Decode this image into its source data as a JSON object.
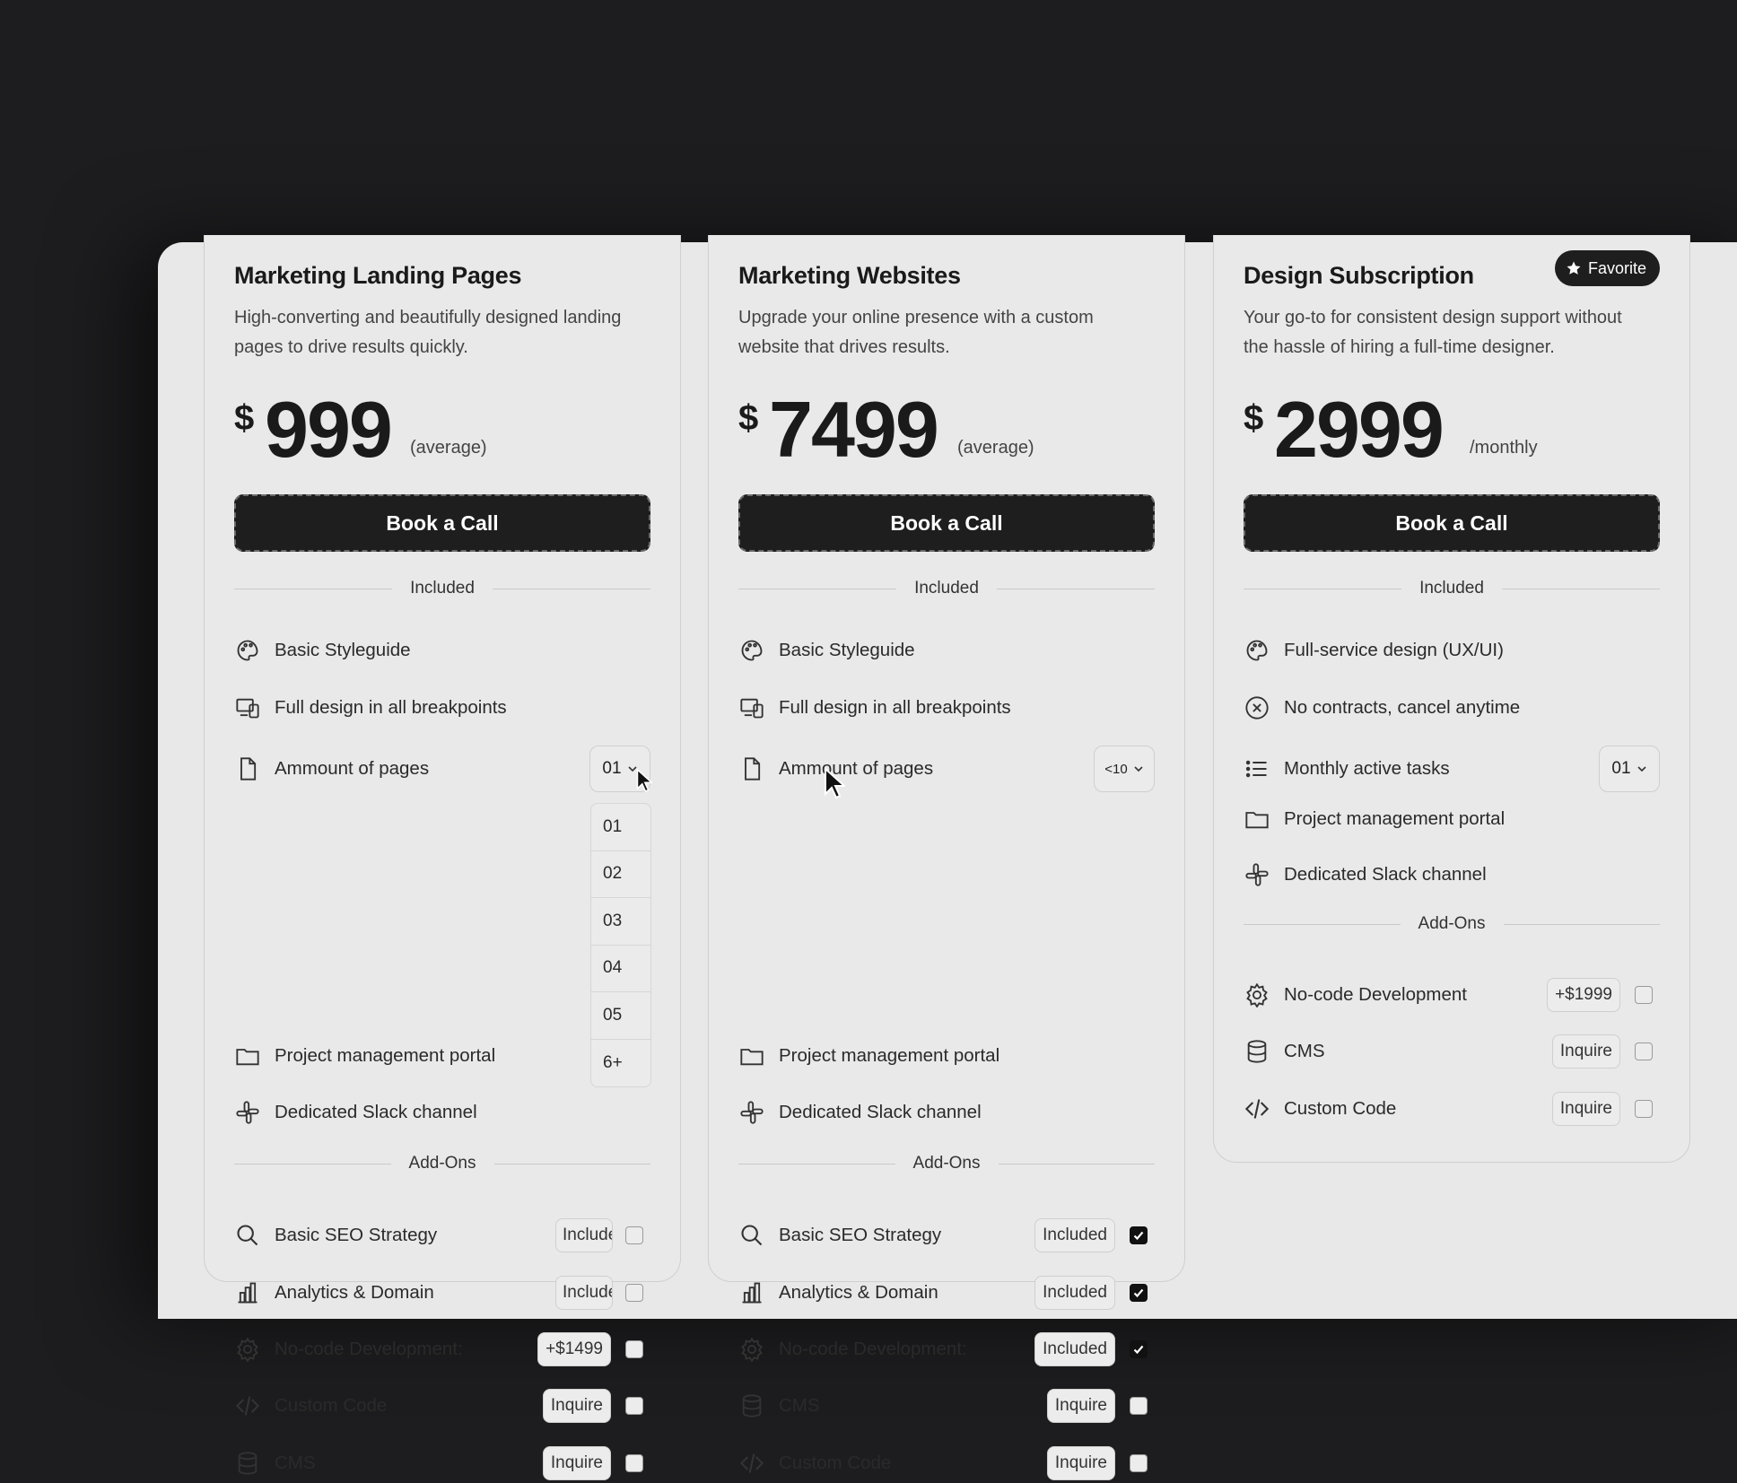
{
  "cards": [
    {
      "title": "Marketing Landing Pages",
      "description": "High-converting and beautifully designed landing pages to drive results quickly.",
      "price": {
        "currency": "$",
        "amount": "999",
        "note": "(average)"
      },
      "cta": "Book a Call",
      "included_label": "Included",
      "included": [
        {
          "icon": "palette-icon",
          "label": "Basic Styleguide"
        },
        {
          "icon": "devices-icon",
          "label": "Full design in all breakpoints"
        },
        {
          "icon": "document-icon",
          "label": "Ammount of pages",
          "select": "01"
        },
        {
          "icon": "folder-icon",
          "label": "Project management portal"
        },
        {
          "icon": "slack-icon",
          "label": "Dedicated Slack channel"
        }
      ],
      "addons_label": "Add-Ons",
      "addons": [
        {
          "icon": "search-icon",
          "label": "Basic SEO Strategy",
          "tag": "Included",
          "checked": true
        },
        {
          "icon": "bar-chart-icon",
          "label": "Analytics & Domain",
          "tag": "Included",
          "checked": true
        },
        {
          "icon": "gear-icon",
          "label": "No-code Development:",
          "tag": "+$1499",
          "checked": false
        },
        {
          "icon": "code-icon",
          "label": "Custom Code",
          "tag": "Inquire",
          "checked": false
        },
        {
          "icon": "database-icon",
          "label": "CMS",
          "tag": "Inquire",
          "checked": false
        }
      ]
    },
    {
      "title": "Marketing Websites",
      "description": "Upgrade your online presence with a custom website that drives results.",
      "price": {
        "currency": "$",
        "amount": "7499",
        "note": "(average)"
      },
      "cta": "Book a Call",
      "included_label": "Included",
      "included": [
        {
          "icon": "palette-icon",
          "label": "Basic Styleguide"
        },
        {
          "icon": "devices-icon",
          "label": "Full design in all breakpoints"
        },
        {
          "icon": "document-icon",
          "label": "Ammount of pages",
          "select": "<10"
        },
        {
          "icon": "folder-icon",
          "label": "Project management portal"
        },
        {
          "icon": "slack-icon",
          "label": "Dedicated Slack channel"
        }
      ],
      "addons_label": "Add-Ons",
      "addons": [
        {
          "icon": "search-icon",
          "label": "Basic SEO Strategy",
          "tag": "Included",
          "checked": true
        },
        {
          "icon": "bar-chart-icon",
          "label": "Analytics & Domain",
          "tag": "Included",
          "checked": true
        },
        {
          "icon": "gear-icon",
          "label": "No-code Development:",
          "tag": "Included",
          "checked": true
        },
        {
          "icon": "database-icon",
          "label": "CMS",
          "tag": "Inquire",
          "checked": false
        },
        {
          "icon": "code-icon",
          "label": "Custom Code",
          "tag": "Inquire",
          "checked": false
        }
      ]
    },
    {
      "title": "Design Subscription",
      "badge": "Favorite",
      "description": "Your go-to for consistent design support without the hassle of hiring a full-time designer.",
      "price": {
        "currency": "$",
        "amount": "2999",
        "note": "/monthly"
      },
      "cta": "Book a Call",
      "included_label": "Included",
      "included": [
        {
          "icon": "palette-icon",
          "label": "Full-service design (UX/UI)"
        },
        {
          "icon": "x-circle-icon",
          "label": "No contracts, cancel anytime"
        },
        {
          "icon": "list-icon",
          "label": "Monthly active tasks",
          "select": "01"
        },
        {
          "icon": "folder-icon",
          "label": "Project management portal"
        },
        {
          "icon": "slack-icon",
          "label": "Dedicated Slack channel"
        }
      ],
      "addons_label": "Add-Ons",
      "addons": [
        {
          "icon": "gear-icon",
          "label": "No-code Development",
          "tag": "+$1999",
          "checked": false
        },
        {
          "icon": "database-icon",
          "label": "CMS",
          "tag": "Inquire",
          "checked": false
        },
        {
          "icon": "code-icon",
          "label": "Custom Code",
          "tag": "Inquire",
          "checked": false
        }
      ]
    }
  ],
  "dropdown": {
    "options": [
      "01",
      "02",
      "03",
      "04",
      "05",
      "6+"
    ]
  }
}
